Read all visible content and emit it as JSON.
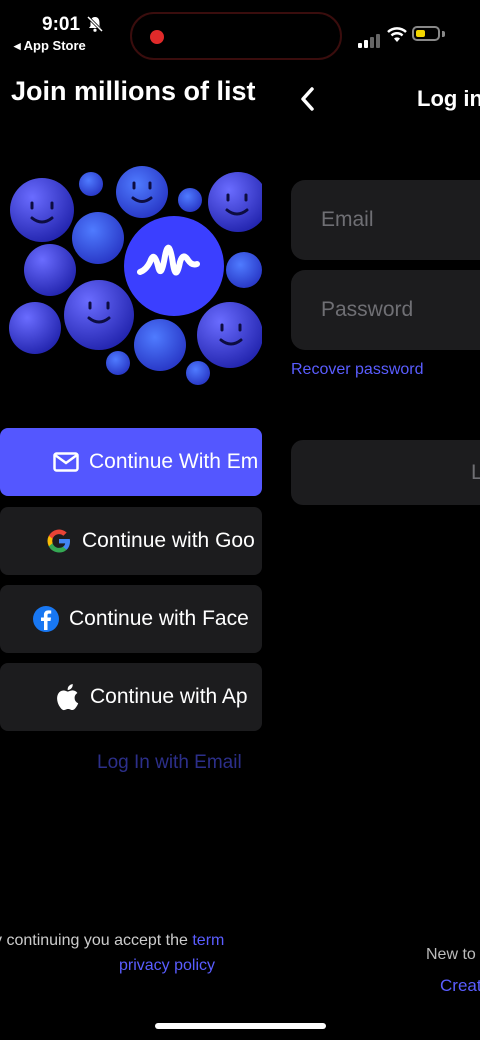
{
  "status_bar": {
    "time": "9:01",
    "back_app": "◂ App Store"
  },
  "welcome": {
    "heading": "Join millions of list",
    "buttons": {
      "email": "Continue With Em",
      "google": "Continue with Goo",
      "facebook": "Continue with Face",
      "apple": "Continue with Ap"
    },
    "login_with_email": "Log In with Email",
    "terms_prefix": "y continuing you accept the ",
    "terms_link": "term",
    "privacy_link": "privacy policy"
  },
  "login": {
    "title": "Log in",
    "email_placeholder": "Email",
    "password_placeholder": "Password",
    "recover": "Recover password",
    "login_button": "L",
    "new_to": "New to",
    "create": "Creat"
  },
  "colors": {
    "accent": "#5457ff",
    "link": "#5a5dff",
    "field_bg": "#1c1c1e"
  }
}
